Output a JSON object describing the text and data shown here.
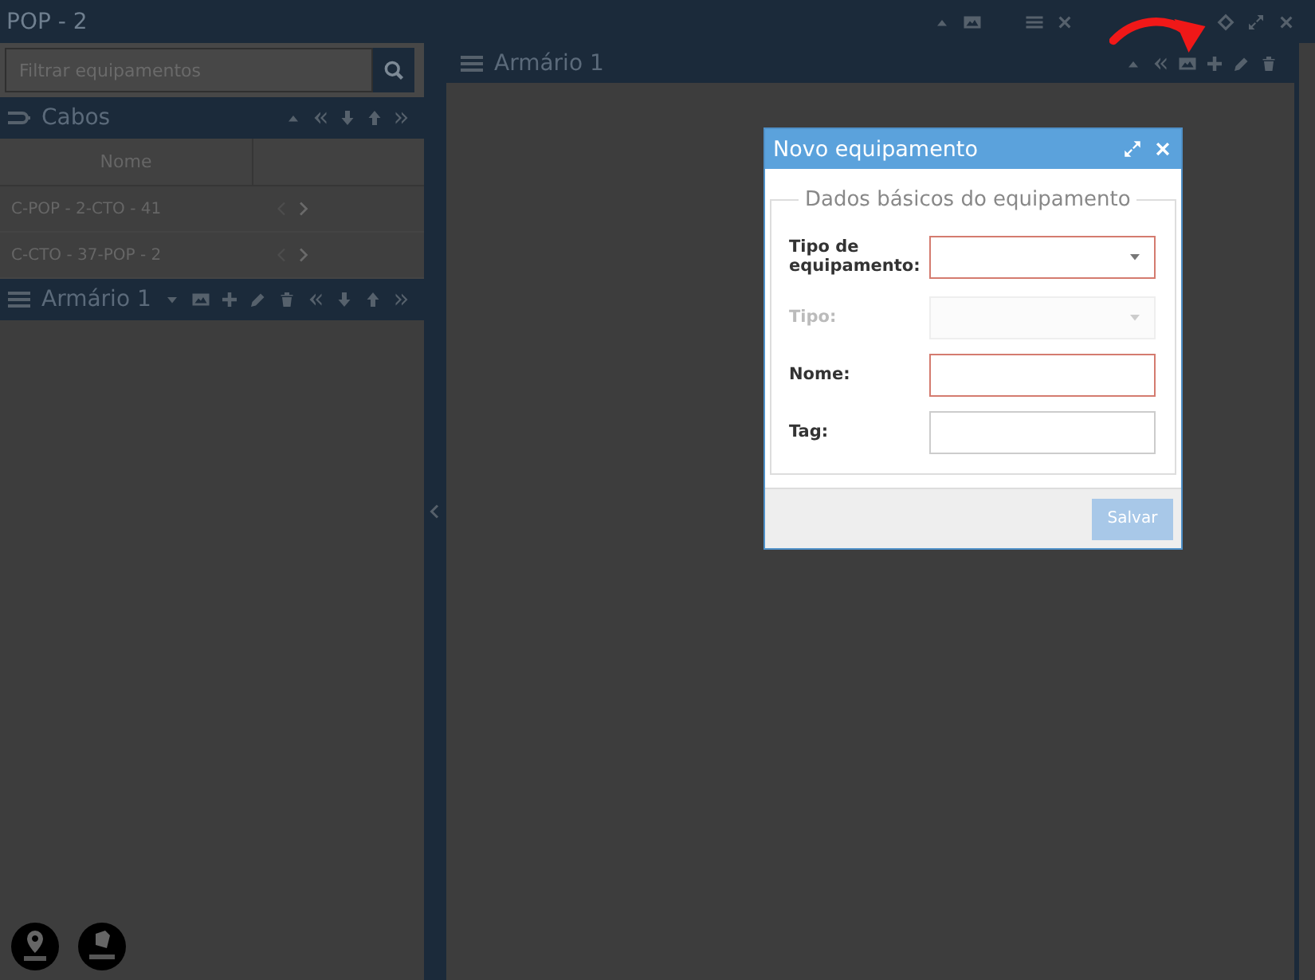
{
  "window": {
    "title": "POP - 2"
  },
  "search": {
    "placeholder": "Filtrar equipamentos"
  },
  "cables": {
    "title": "Cabos",
    "columns": [
      "Nome"
    ],
    "rows": [
      {
        "name": "C-POP - 2-CTO - 41"
      },
      {
        "name": "C-CTO - 37-POP - 2"
      }
    ]
  },
  "cabinet_section": {
    "title": "Armário 1"
  },
  "cabinet_panel": {
    "title": "Armário 1"
  },
  "dialog": {
    "title": "Novo equipamento",
    "legend": "Dados básicos do equipamento",
    "fields": [
      {
        "label": "Tipo de equipamento:",
        "kind": "select",
        "disabled": false,
        "invalid": true
      },
      {
        "label": "Tipo:",
        "kind": "select",
        "disabled": true,
        "invalid": false
      },
      {
        "label": "Nome:",
        "kind": "text",
        "disabled": false,
        "invalid": true
      },
      {
        "label": "Tag:",
        "kind": "text",
        "disabled": false,
        "invalid": false
      }
    ],
    "save": {
      "label": "Salvar",
      "disabled": true
    }
  }
}
